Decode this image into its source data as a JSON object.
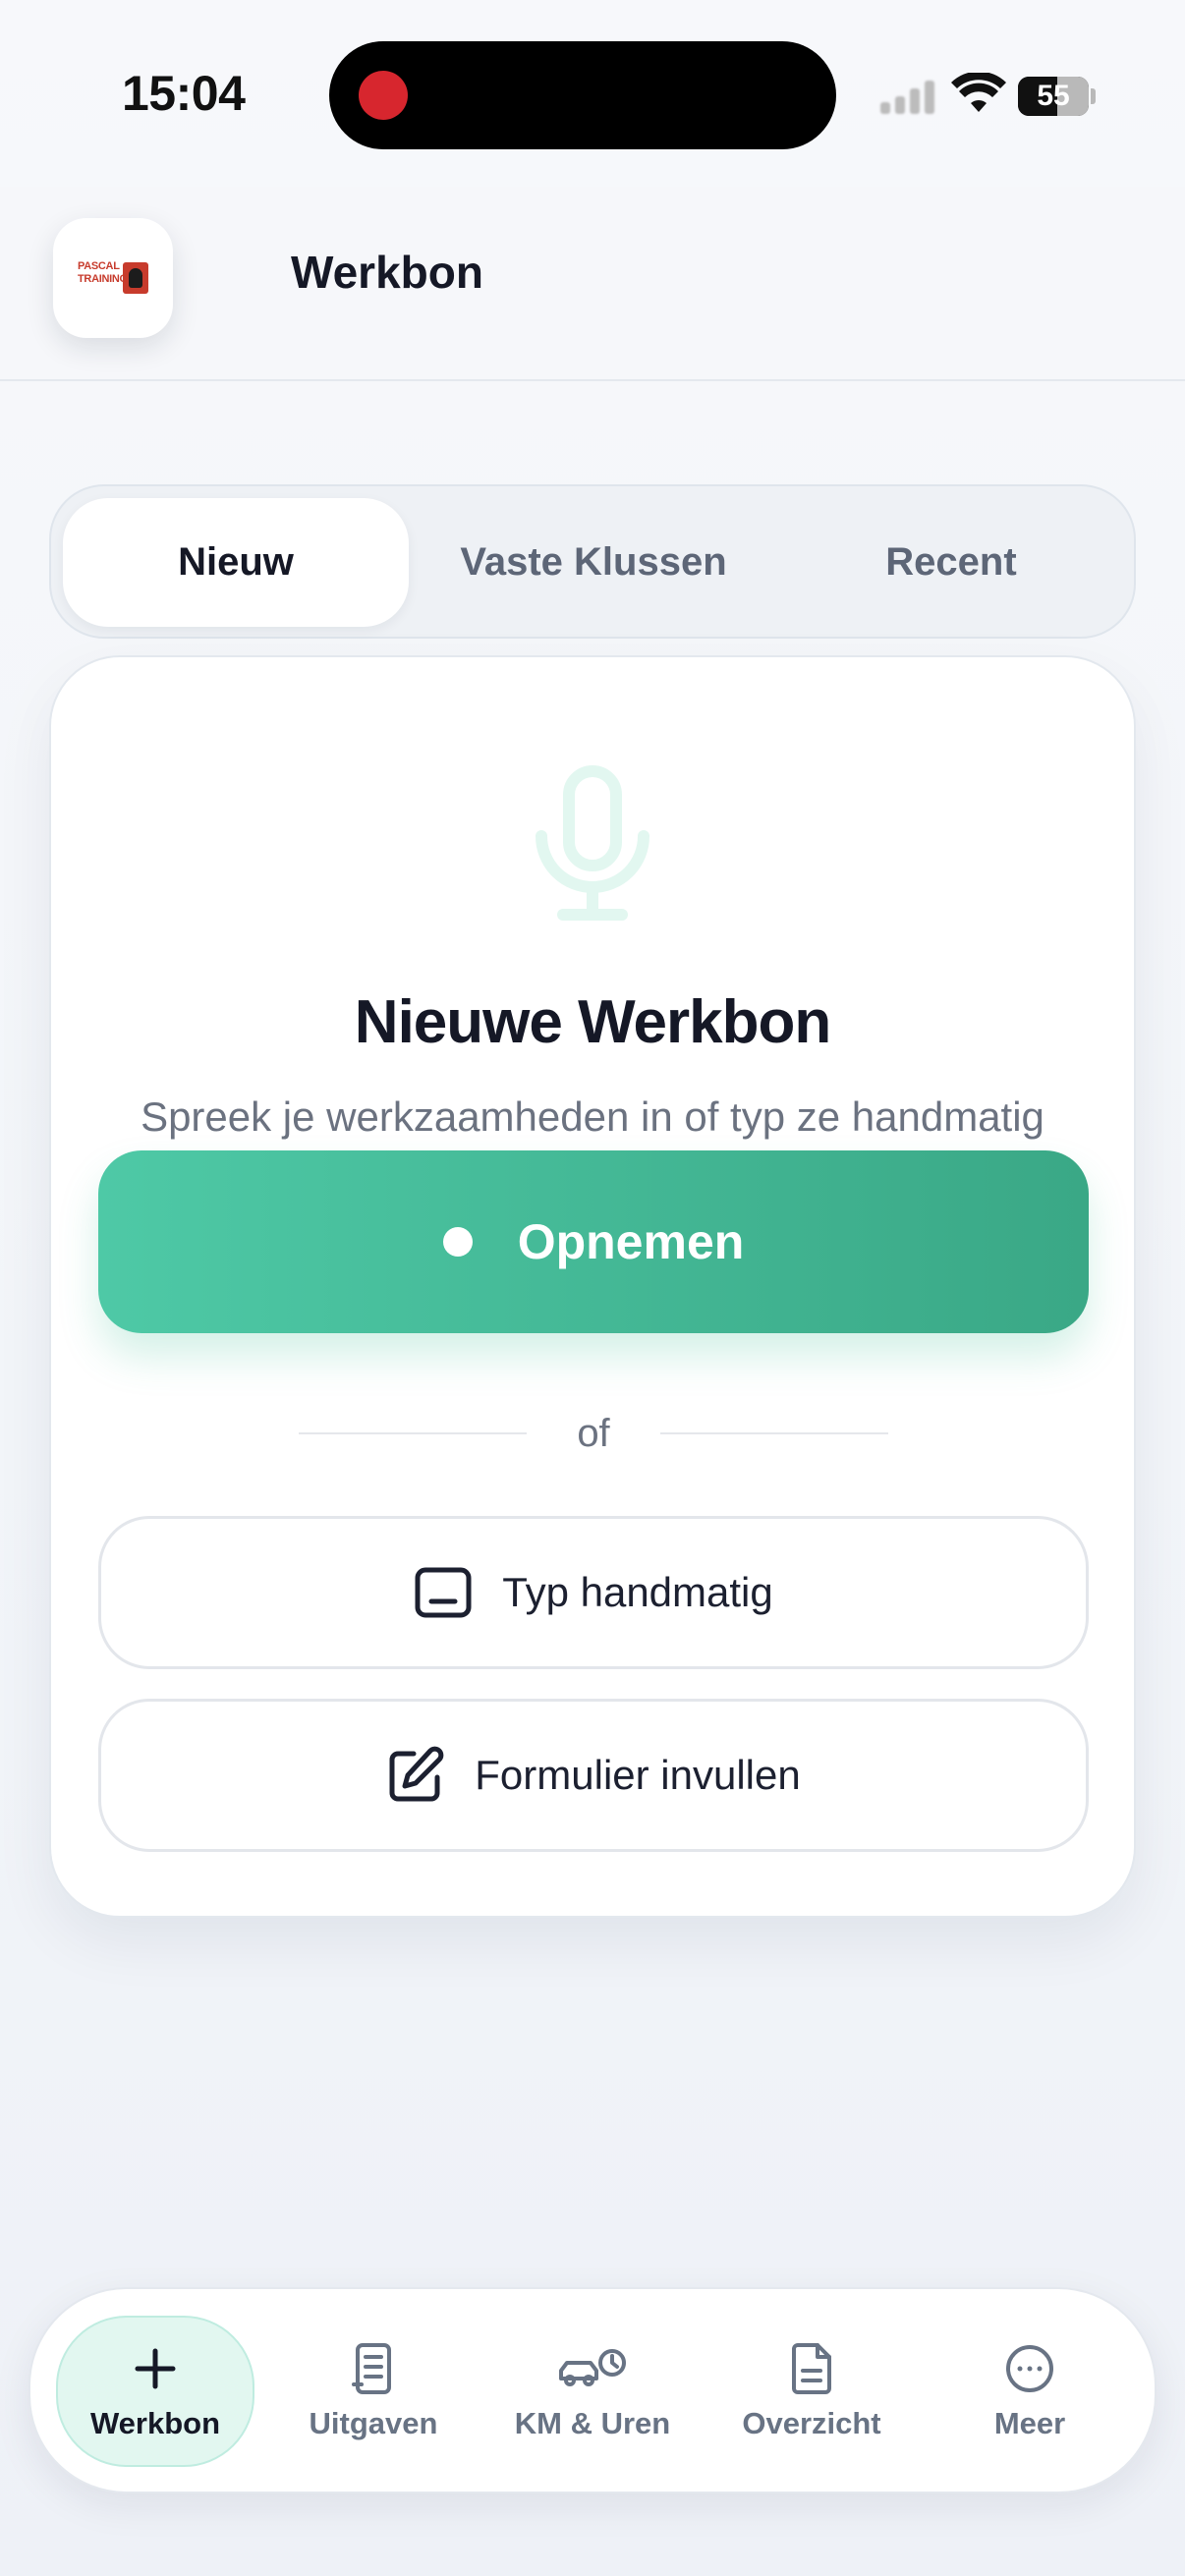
{
  "status_bar": {
    "time": "15:04",
    "battery": "55"
  },
  "header": {
    "logo_text": "PASCAL TRAINING",
    "title": "Werkbon"
  },
  "tabs": [
    {
      "label": "Nieuw",
      "active": true
    },
    {
      "label": "Vaste Klussen",
      "active": false
    },
    {
      "label": "Recent",
      "active": false
    }
  ],
  "card": {
    "icon": "microphone-icon",
    "title": "Nieuwe Werkbon",
    "subtitle": "Spreek je werkzaamheden in of typ ze handmatig",
    "record_label": "Opnemen",
    "divider_text": "of",
    "type_manual_label": "Typ handmatig",
    "type_manual_icon": "keyboard-icon",
    "form_label": "Formulier invullen",
    "form_icon": "edit-icon"
  },
  "bottom_nav": [
    {
      "label": "Werkbon",
      "icon": "plus-icon",
      "active": true
    },
    {
      "label": "Uitgaven",
      "icon": "receipt-icon",
      "active": false
    },
    {
      "label": "KM & Uren",
      "icon": "car-clock-icon",
      "active": false
    },
    {
      "label": "Overzicht",
      "icon": "document-icon",
      "active": false
    },
    {
      "label": "Meer",
      "icon": "more-icon",
      "active": false
    }
  ],
  "colors": {
    "accent": "#45bb97",
    "accent_light": "#e2f7f0",
    "text_primary": "#151826",
    "text_secondary": "#6b7280"
  }
}
